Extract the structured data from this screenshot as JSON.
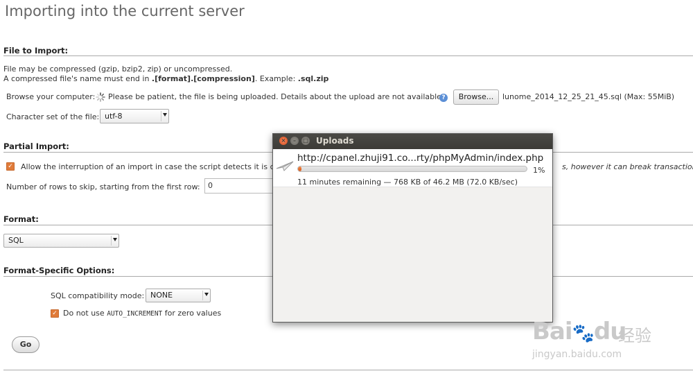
{
  "page": {
    "title": "Importing into the current server"
  },
  "file_import": {
    "heading": "File to Import:",
    "line1": "File may be compressed (gzip, bzip2, zip) or uncompressed.",
    "line2_prefix": "A compressed file's name must end in ",
    "line2_format": ".[format].[compression]",
    "line2_mid": ". Example: ",
    "line2_example": ".sql.zip",
    "browse_label": "Browse your computer:",
    "upload_message": "Please be patient, the file is being uploaded. Details about the upload are not available.",
    "browse_button": "Browse...",
    "selected_file": "lunome_2014_12_25_21_45.sql",
    "max_size": "(Max: 55MiB)",
    "charset_label": "Character set of the file:",
    "charset_value": "utf-8"
  },
  "partial_import": {
    "heading": "Partial Import:",
    "allow_interrupt_left": "Allow the interruption of an import in case the script detects it is cl",
    "allow_interrupt_right": "s, however it can break transactions.)",
    "allow_interrupt_checked": true,
    "skip_rows_label": "Number of rows to skip, starting from the first row:",
    "skip_rows_value": "0"
  },
  "format": {
    "heading": "Format:",
    "value": "SQL"
  },
  "format_options": {
    "heading": "Format-Specific Options:",
    "compat_label": "SQL compatibility mode:",
    "compat_value": "NONE",
    "auto_inc_prefix": "Do not use ",
    "auto_inc_code": "AUTO_INCREMENT",
    "auto_inc_suffix": " for zero values",
    "auto_inc_checked": true
  },
  "go_button": "Go",
  "uploads_window": {
    "title": "Uploads",
    "url": "http://cpanel.zhuji91.co...rty/phpMyAdmin/index.php",
    "percent_text": "1%",
    "progress": 0.01,
    "status": "11 minutes remaining — 768 KB of 46.2 MB (72.0 KB/sec)"
  },
  "watermark": {
    "brand": "Bai",
    "brand2": "du",
    "chinese": "经验",
    "url": "jingyan.baidu.com"
  },
  "colors": {
    "accent": "#e07b3a",
    "titlebar": "#3c3b37",
    "close_button": "#e5572a"
  },
  "icons": {
    "spinner": "loading-spinner-icon",
    "help": "help-icon",
    "download": "paper-plane-icon"
  }
}
